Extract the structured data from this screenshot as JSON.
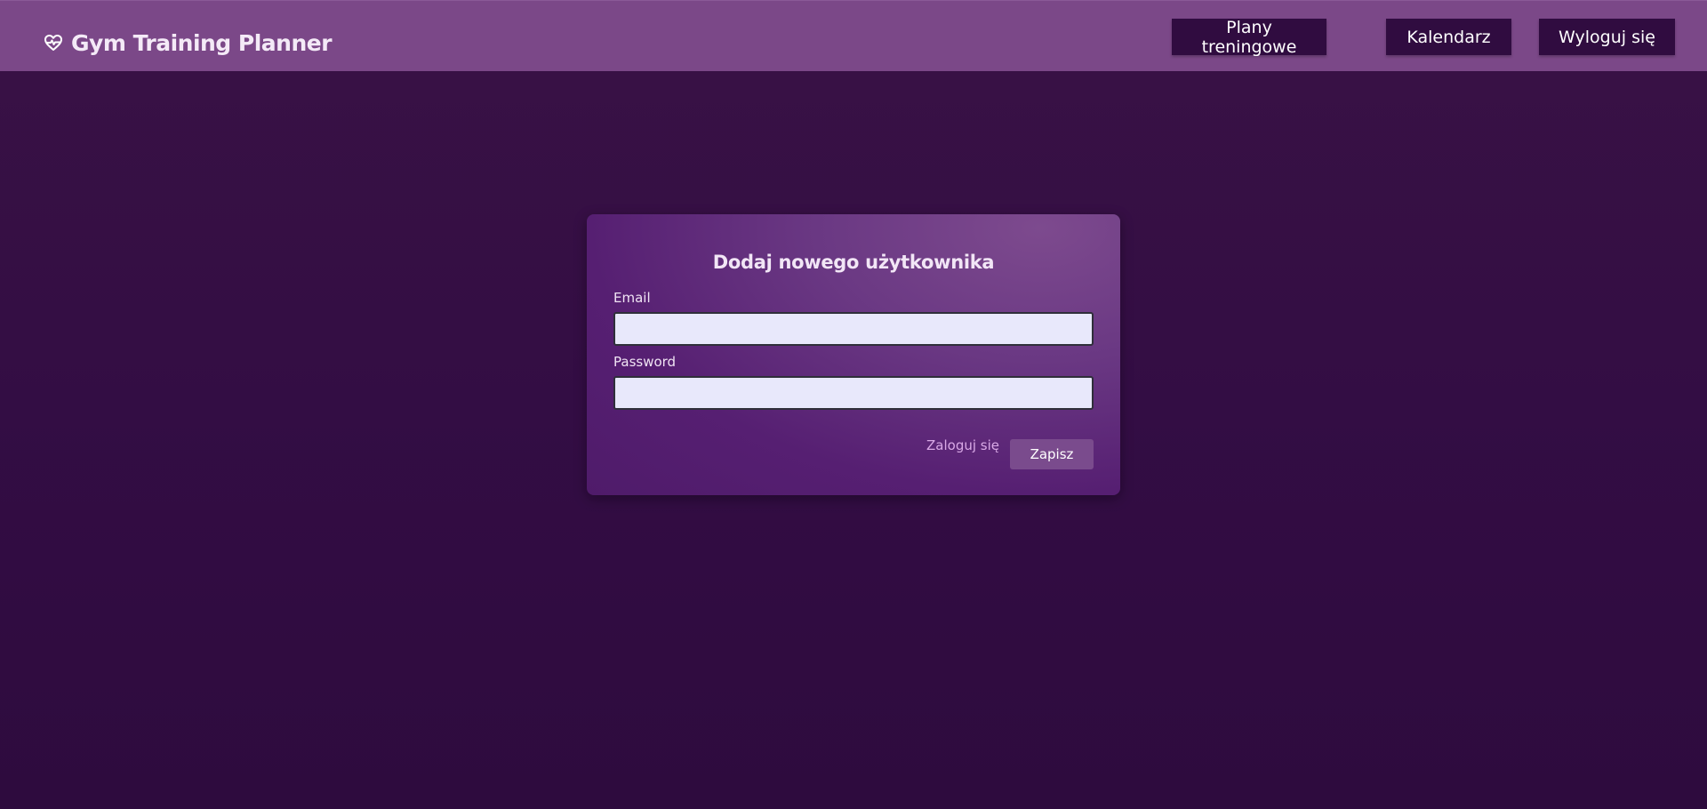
{
  "header": {
    "brand_title": "Gym Training Planner",
    "brand_icon": "heart-pulse-icon",
    "nav": [
      {
        "label": "Plany treningowe"
      },
      {
        "label": "Kalendarz"
      },
      {
        "label": "Wyloguj się"
      }
    ],
    "bg_color": "#7b4888",
    "button_color": "#300c40"
  },
  "form": {
    "title": "Dodaj nowego użytkownika",
    "email_label": "Email",
    "email_value": "",
    "password_label": "Password",
    "password_value": "",
    "login_link": "Zaloguj się",
    "save_label": "Zapisz"
  },
  "colors": {
    "page_bg": "#330d44",
    "card_bg": "#5a2477",
    "input_bg": "#e8e8fb",
    "link": "#d9a9e6"
  }
}
